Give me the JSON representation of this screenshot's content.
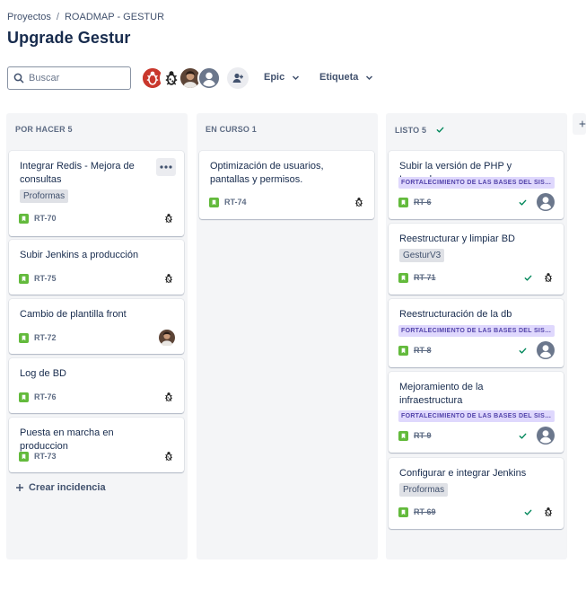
{
  "breadcrumb": {
    "projects": "Proyectos",
    "separator": "/",
    "project": "ROADMAP - GESTUR"
  },
  "page_title": "Upgrade Gestur",
  "search": {
    "placeholder": "Buscar"
  },
  "filters": {
    "epic": "Epic",
    "label": "Etiqueta"
  },
  "columns": [
    {
      "title": "POR HACER 5"
    },
    {
      "title": "EN CURSO 1"
    },
    {
      "title": "LISTO 5"
    }
  ],
  "todo": {
    "c1": {
      "title": "Integrar Redis - Mejora de consultas",
      "label": "Proformas",
      "key": "RT-70"
    },
    "c2": {
      "title": "Subir Jenkins a producción",
      "key": "RT-75"
    },
    "c3": {
      "title": "Cambio de plantilla front",
      "key": "RT-72"
    },
    "c4": {
      "title": "Log de BD",
      "key": "RT-76"
    },
    "c5": {
      "title": "Puesta en marcha en produccion",
      "key": "RT-73"
    },
    "create": "Crear incidencia"
  },
  "inprogress": {
    "c1": {
      "title": "Optimización de usuarios, pantallas y permisos.",
      "key": "RT-74"
    }
  },
  "done": {
    "c1": {
      "title": "Subir la versión de PHP y Laravel",
      "epic": "FORTALECIMIENTO DE LAS BASES DEL SISTEMA",
      "key": "RT-6"
    },
    "c2": {
      "title": "Reestructurar y limpiar BD",
      "label": "GesturV3",
      "key": "RT-71"
    },
    "c3": {
      "title": "Reestructuración de la db",
      "epic": "FORTALECIMIENTO DE LAS BASES DEL SISTEMA",
      "key": "RT-8"
    },
    "c4": {
      "title": "Mejoramiento de la infraestructura",
      "epic": "FORTALECIMIENTO DE LAS BASES DEL SISTEMA",
      "key": "RT-9"
    },
    "c5": {
      "title": "Configurar e integrar Jenkins",
      "label": "Proformas",
      "key": "RT-69"
    }
  },
  "colors": {
    "story_green": "#63ba3c",
    "done_check": "#00875a",
    "epic_bg": "#dfd8fd",
    "epic_text": "#5243aa"
  },
  "icons": [
    "search-icon",
    "chevron-down-icon",
    "add-people-icon",
    "story-icon",
    "bug-avatar-icon",
    "user-avatar-icon",
    "check-icon",
    "plus-icon",
    "more-icon"
  ]
}
